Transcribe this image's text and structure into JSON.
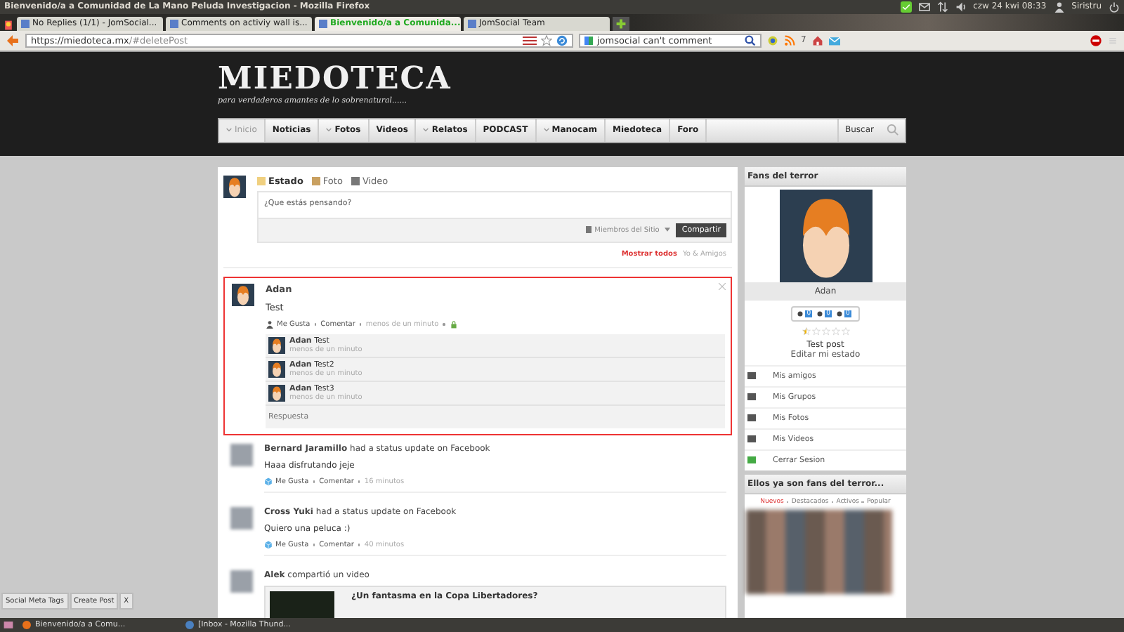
{
  "os_panel": {
    "title": "Bienvenido/a a Comunidad de La Mano Peluda Investigacion - Mozilla Firefox",
    "clock": "czw 24 kwi 08:33",
    "user": "Siristru"
  },
  "tabs": [
    {
      "label": "No Replies (1/1) - JomSocial...",
      "selected": false
    },
    {
      "label": "Comments on activiy wall is...",
      "selected": false
    },
    {
      "label": "Bienvenido/a a Comunida...",
      "selected": true
    },
    {
      "label": "JomSocial Team",
      "selected": false
    }
  ],
  "url": {
    "host": "https://miedoteca.mx",
    "path": "/#deletePost"
  },
  "search": {
    "value": "jomsocial can't comment"
  },
  "addon_badge": "7",
  "site": {
    "logo": "MIEDOTECA",
    "tagline": "para verdaderos amantes de lo sobrenatural......",
    "search_label": "Buscar",
    "menu": [
      {
        "label": "Inicio",
        "dropdown": true,
        "selected": true
      },
      {
        "label": "Noticias",
        "dropdown": false,
        "selected": false
      },
      {
        "label": "Fotos",
        "dropdown": true,
        "selected": false
      },
      {
        "label": "Videos",
        "dropdown": false,
        "selected": false
      },
      {
        "label": "Relatos",
        "dropdown": true,
        "selected": false
      },
      {
        "label": "PODCAST",
        "dropdown": false,
        "selected": false
      },
      {
        "label": "Manocam",
        "dropdown": true,
        "selected": false
      },
      {
        "label": "Miedoteca",
        "dropdown": false,
        "selected": false
      },
      {
        "label": "Foro",
        "dropdown": false,
        "selected": false
      }
    ]
  },
  "composer": {
    "tabs": [
      {
        "label": "Estado",
        "kind": "status",
        "selected": true
      },
      {
        "label": "Foto",
        "kind": "photo",
        "selected": false
      },
      {
        "label": "Video",
        "kind": "video",
        "selected": false
      }
    ],
    "placeholder": "¿Que estás pensando?",
    "privacy": "Miembros del Sitio",
    "button": "Compartir",
    "filters": [
      {
        "label": "Mostrar todos",
        "selected": true
      },
      {
        "label": "Yo & Amigos",
        "selected": false
      }
    ]
  },
  "post": {
    "highlighted": true,
    "author": "Adan",
    "text": "Test",
    "like": "Me Gusta",
    "comment": "Comentar",
    "time": "menos de un minuto",
    "reply_placeholder": "Respuesta",
    "comments": [
      {
        "author": "Adan",
        "text": "Test",
        "time": "menos de un minuto"
      },
      {
        "author": "Adan",
        "text": "Test2",
        "time": "menos de un minuto"
      },
      {
        "author": "Adan",
        "text": "Test3",
        "time": "menos de un minuto"
      }
    ]
  },
  "feed": [
    {
      "kind": "status",
      "author": "Bernard Jaramillo",
      "action": "had a status update on",
      "source": "Facebook",
      "text": "Haaa disfrutando jeje",
      "like": "Me Gusta",
      "comment": "Comentar",
      "time": "16 minutos"
    },
    {
      "kind": "status",
      "author": "Cross Yuki",
      "action": "had a status update on",
      "source": "Facebook",
      "text": "Quiero una peluca :)",
      "like": "Me Gusta",
      "comment": "Comentar",
      "time": "40 minutos"
    },
    {
      "kind": "video",
      "author": "Alek",
      "action": "compartió un video",
      "video_title": "¿Un fantasma en la Copa Libertadores?"
    }
  ],
  "sidebar": {
    "title": "Fans del terror",
    "name": "Adan",
    "counts": [
      "0",
      "0",
      "0"
    ],
    "stars": 0.5,
    "status": "Test post",
    "edit": "Editar mi estado",
    "links": [
      {
        "label": "Mis amigos",
        "kind": "friends"
      },
      {
        "label": "Mis Grupos",
        "kind": "groups"
      },
      {
        "label": "Mis Fotos",
        "kind": "photos"
      },
      {
        "label": "Mis Videos",
        "kind": "videos"
      },
      {
        "label": "Cerrar Sesion",
        "kind": "logout"
      }
    ],
    "fans_title": "Ellos ya son fans del terror...",
    "fan_tabs": [
      {
        "label": "Nuevos",
        "selected": true
      },
      {
        "label": "Destacados",
        "selected": false
      },
      {
        "label": "Activos",
        "selected": false
      },
      {
        "label": "Popular",
        "selected": false
      }
    ]
  },
  "floating_buttons": [
    "Social Meta Tags",
    "Create Post",
    "X"
  ],
  "taskbar": [
    "Bienvenido/a a Comu...",
    "[Inbox - Mozilla Thund..."
  ]
}
